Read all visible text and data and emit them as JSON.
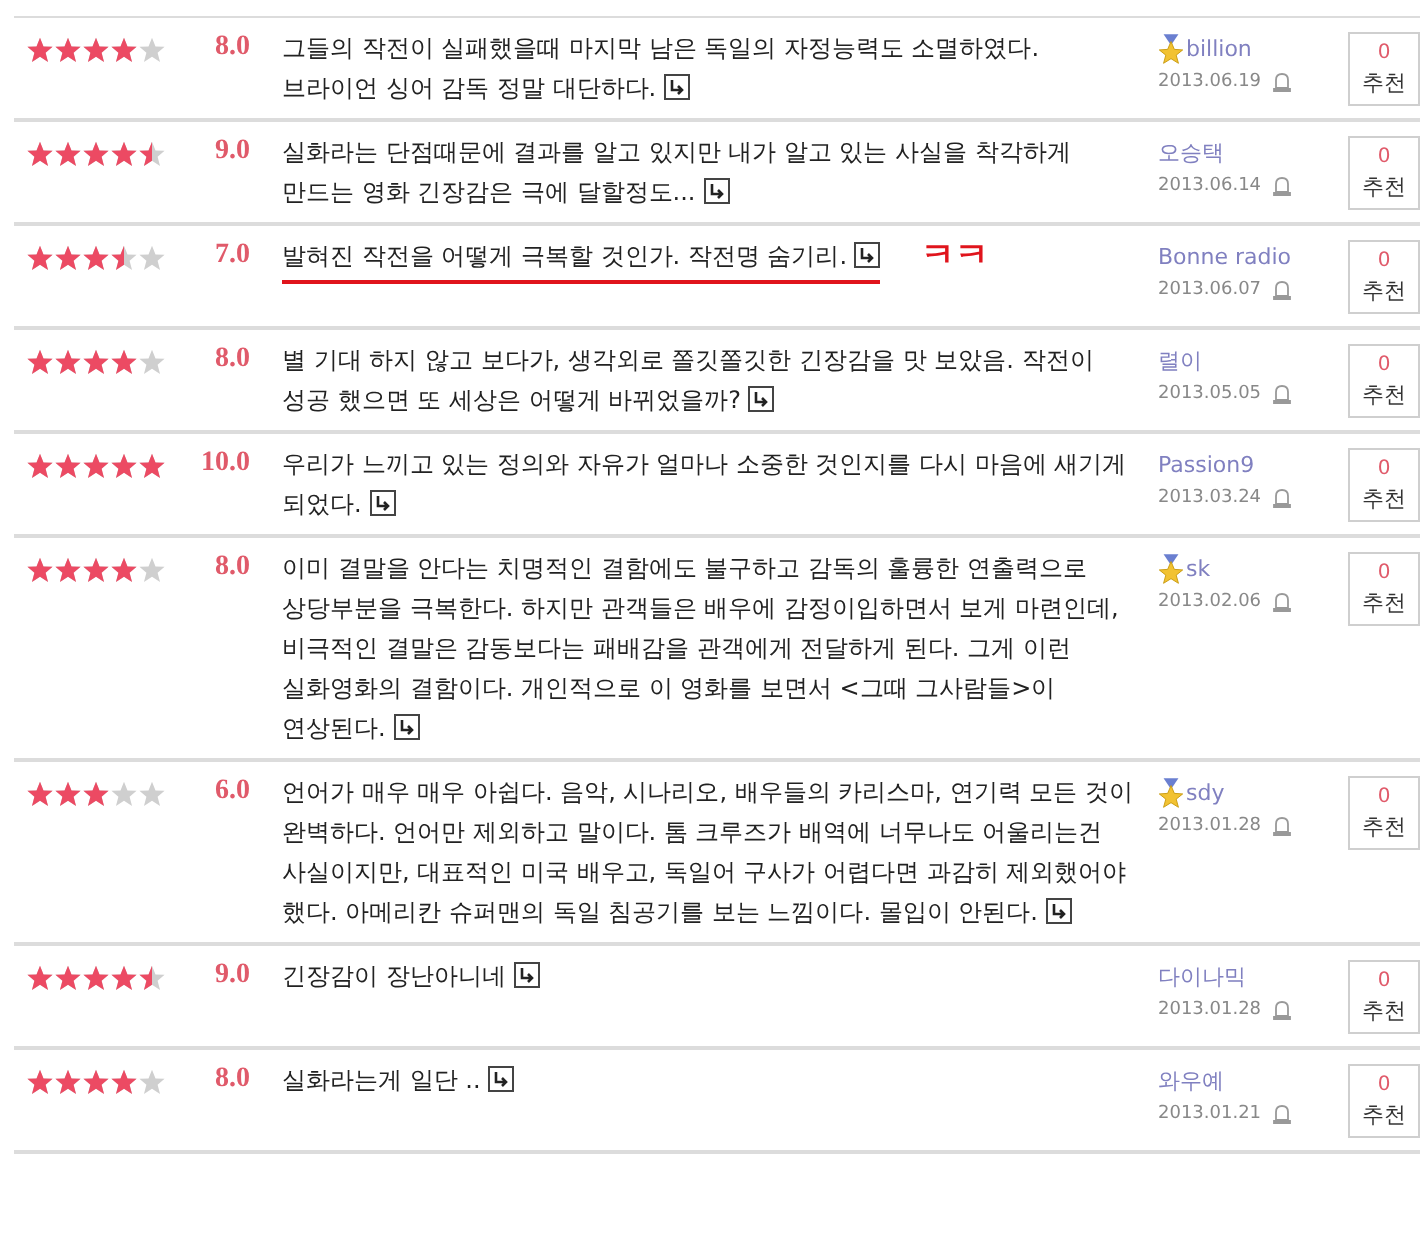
{
  "reviews": [
    {
      "stars": 4,
      "score": "8.0",
      "text": "그들의 작전이 실패했을때 마지막 남은 독일의 자정능력도 소멸하였다. 브라이언 싱어 감독 정말 대단하다.",
      "user": "billion",
      "badge": true,
      "date": "2013.06.19",
      "count": "0",
      "button": "추천"
    },
    {
      "stars": 4.5,
      "score": "9.0",
      "text": "실화라는 단점때문에 결과를 알고 있지만 내가 알고 있는 사실을 착각하게 만드는 영화 긴장감은 극에 달할정도...",
      "user": "오승택",
      "badge": false,
      "date": "2013.06.14",
      "count": "0",
      "button": "추천"
    },
    {
      "stars": 3.5,
      "score": "7.0",
      "text": "발혀진 작전을 어떻게 극복할 것인가. 작전명 숨기리.",
      "user": "Bonne radio",
      "badge": false,
      "date": "2013.06.07",
      "count": "0",
      "button": "추천",
      "annotation": "ㅋㅋ"
    },
    {
      "stars": 4,
      "score": "8.0",
      "text": "별 기대 하지 않고 보다가, 생각외로 쫄깃쫄깃한 긴장감을 맛 보았음. 작전이 성공 했으면 또 세상은 어떻게 바뀌었을까?",
      "user": "렬이",
      "badge": false,
      "date": "2013.05.05",
      "count": "0",
      "button": "추천"
    },
    {
      "stars": 5,
      "score": "10.0",
      "text": "우리가 느끼고 있는 정의와 자유가 얼마나 소중한 것인지를 다시 마음에 새기게 되었다.",
      "user": "Passion9",
      "badge": false,
      "date": "2013.03.24",
      "count": "0",
      "button": "추천"
    },
    {
      "stars": 4,
      "score": "8.0",
      "text": "이미 결말을 안다는 치명적인 결함에도 불구하고 감독의 훌륭한 연출력으로 상당부분을 극복한다. 하지만 관객들은 배우에 감정이입하면서 보게 마련인데, 비극적인 결말은 감동보다는 패배감을 관객에게 전달하게 된다. 그게 이런 실화영화의 결함이다. 개인적으로 이 영화를 보면서 <그때 그사람들>이 연상된다.",
      "user": "sk",
      "badge": true,
      "date": "2013.02.06",
      "count": "0",
      "button": "추천"
    },
    {
      "stars": 3,
      "score": "6.0",
      "text": "언어가 매우 매우 아쉽다. 음악, 시나리오, 배우들의 카리스마, 연기력 모든 것이 완벽하다. 언어만 제외하고 말이다. 톰 크루즈가 배역에 너무나도 어울리는건 사실이지만, 대표적인 미국 배우고, 독일어 구사가 어렵다면 과감히 제외했어야 했다. 아메리칸 슈퍼맨의 독일 침공기를 보는 느낌이다. 몰입이 안된다.",
      "user": "sdy",
      "badge": true,
      "date": "2013.01.28",
      "count": "0",
      "button": "추천"
    },
    {
      "stars": 4.5,
      "score": "9.0",
      "text": "긴장감이 장난아니네",
      "user": "다이나믹",
      "badge": false,
      "date": "2013.01.28",
      "count": "0",
      "button": "추천"
    },
    {
      "stars": 4,
      "score": "8.0",
      "text": "실화라는게 일단 ..",
      "user": "와우예",
      "badge": false,
      "date": "2013.01.21",
      "count": "0",
      "button": "추천"
    }
  ]
}
